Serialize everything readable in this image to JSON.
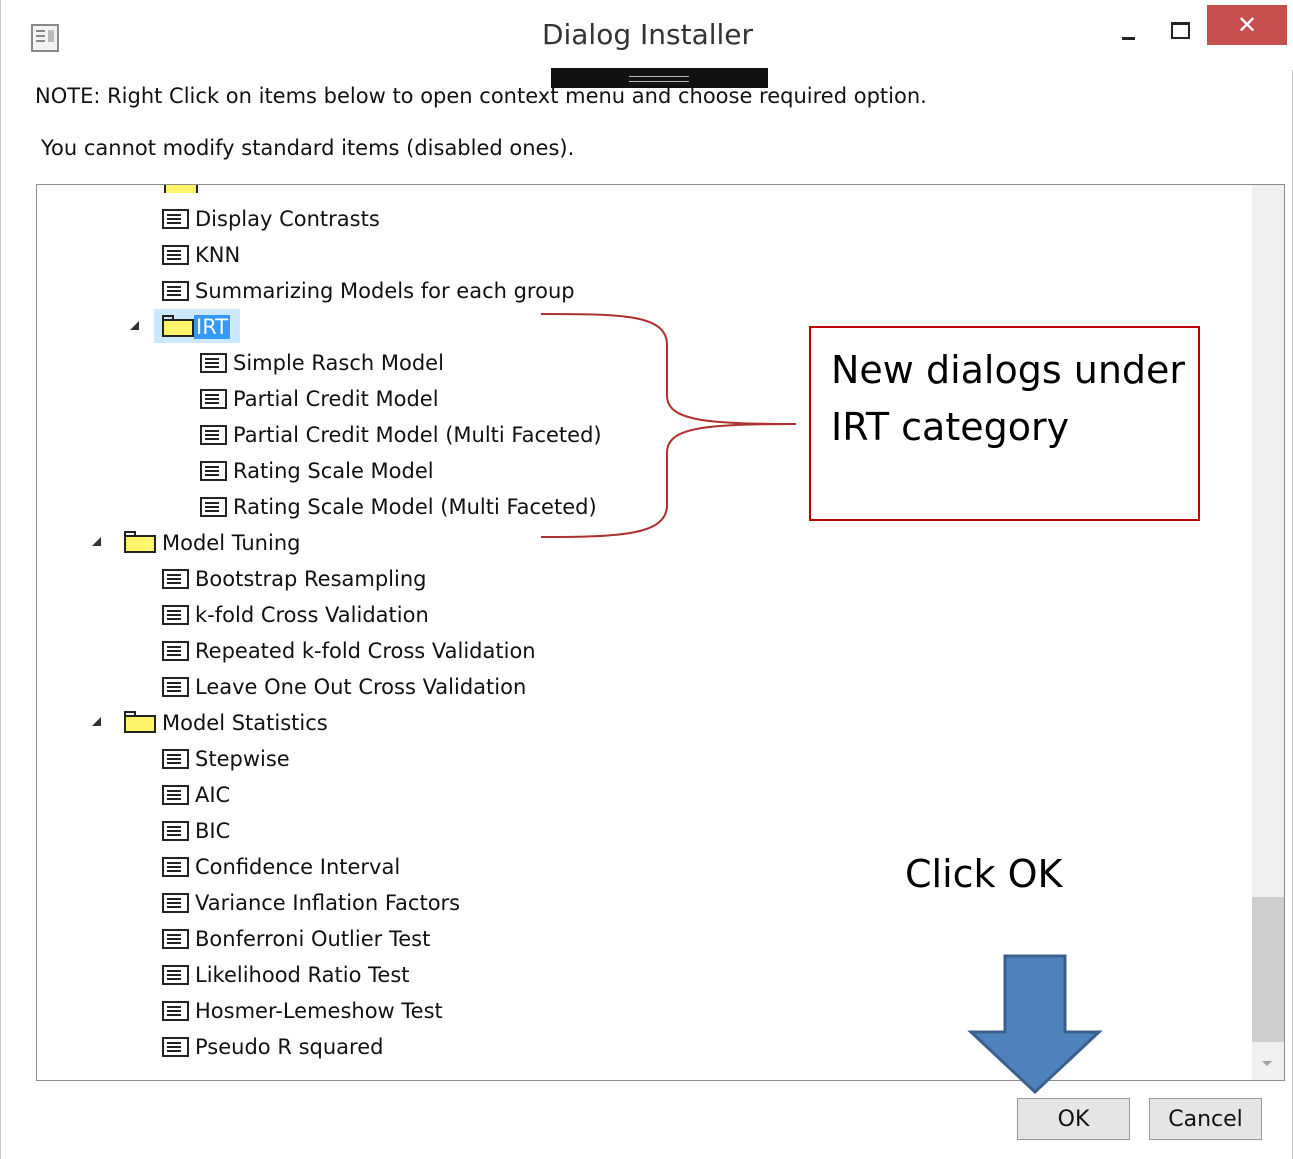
{
  "window": {
    "title": "Dialog Installer",
    "close_glyph": "✕"
  },
  "notes": {
    "note": "NOTE: Right Click on items below to open context menu and choose required option.",
    "subnote": "You cannot modify standard items (disabled ones)."
  },
  "tree": {
    "items_top": [
      "Display Contrasts",
      "KNN",
      "Summarizing Models for each group"
    ],
    "irt_folder": "IRT",
    "irt_items": [
      "Simple Rasch Model",
      "Partial Credit Model",
      "Partial Credit Model (Multi Faceted)",
      "Rating Scale Model",
      "Rating Scale Model (Multi Faceted)"
    ],
    "tuning_folder": "Model Tuning",
    "tuning_items": [
      "Bootstrap Resampling",
      "k-fold Cross Validation",
      "Repeated k-fold Cross Validation",
      "Leave One Out Cross Validation"
    ],
    "stats_folder": "Model Statistics",
    "stats_items": [
      "Stepwise",
      "AIC",
      "BIC",
      "Confidence Interval",
      "Variance Inflation Factors",
      "Bonferroni Outlier Test",
      "Likelihood Ratio Test",
      "Hosmer-Lemeshow Test",
      "Pseudo R squared"
    ]
  },
  "annotations": {
    "callout": "New dialogs under IRT category",
    "click_ok": "Click OK"
  },
  "buttons": {
    "ok": "OK",
    "cancel": "Cancel"
  },
  "colors": {
    "accent_selection": "#3399ff",
    "close_red": "#c7504f",
    "folder_yellow": "#fff46a",
    "arrow_blue": "#4f81bd",
    "callout_border": "#c00000"
  },
  "icons": {
    "item": "dialog-item-icon",
    "folder": "folder-icon",
    "expanded": "expand-arrow-icon"
  }
}
